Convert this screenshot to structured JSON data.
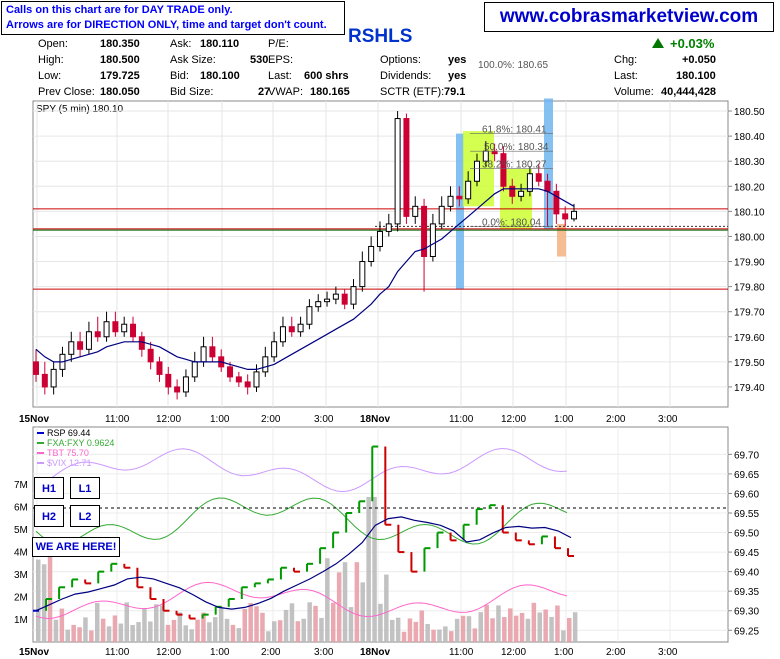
{
  "header": {
    "notice_line1": "Calls on this chart are for DAY TRADE only.",
    "notice_line2": "Arrows are for DIRECTION ONLY, time and target don't count.",
    "website": "www.cobrasmarketview.com",
    "symbol": "RSHLS",
    "change_pct": "+0.03%"
  },
  "quote": {
    "open_label": "Open:",
    "open": "180.350",
    "high_label": "High:",
    "high": "180.500",
    "low_label": "Low:",
    "low": "179.725",
    "prev_close_label": "Prev Close:",
    "prev_close": "180.050",
    "ask_label": "Ask:",
    "ask": "180.110",
    "ask_size_label": "Ask Size:",
    "ask_size": "530",
    "bid_label": "Bid:",
    "bid": "180.100",
    "bid_size_label": "Bid Size:",
    "bid_size": "27",
    "pe_label": "P/E:",
    "eps_label": "EPS:",
    "last_size_label": "Last:",
    "last_size": "600 shrs",
    "vwap_label": "VWAP:",
    "vwap": "180.165",
    "options_label": "Options:",
    "options": "yes",
    "dividends_label": "Dividends:",
    "dividends": "yes",
    "sctr_label": "SCTR (ETF):",
    "sctr": "79.1",
    "chg_label": "Chg:",
    "chg": "+0.050",
    "last_label": "Last:",
    "last": "180.100",
    "volume_label": "Volume:",
    "volume": "40,444,428"
  },
  "colors": {
    "up": "#000000",
    "down": "#cc0033",
    "ma": "#000080",
    "fib_blue": "#6fb6f0",
    "fib_green": "#ccff33",
    "fib_orange": "#f5b183",
    "hline": "#cc0000",
    "support": "#006600",
    "rsp_up": "#009900",
    "rsp_down": "#cc0000",
    "rsp_flat": "#0000cc",
    "fxy": "#33aa33",
    "tbt": "#ff66cc",
    "vix": "#cc99ff",
    "vol": "#bbbbbb",
    "vol_down": "#e8a0a8"
  },
  "labels": {
    "reset_h1": "H1",
    "reset_l1": "L1",
    "reset_h2": "H2",
    "reset_l2": "L2",
    "we_are_here": "WE ARE HERE!"
  },
  "chart_data": [
    {
      "type": "candlestick",
      "title": "SPY (5 min) 180.10",
      "x_ticks": [
        "15Nov",
        "11:00",
        "12:00",
        "1:00",
        "2:00",
        "3:00",
        "18Nov",
        "11:00",
        "12:00",
        "1:00",
        "2:00",
        "3:00"
      ],
      "ylim": [
        179.32,
        180.54
      ],
      "y_ticks": [
        180.5,
        180.4,
        180.3,
        180.2,
        180.1,
        180.0,
        179.9,
        179.8,
        179.7,
        179.6,
        179.5,
        179.4
      ],
      "close": [
        179.45,
        179.4,
        179.47,
        179.53,
        179.58,
        179.55,
        179.62,
        179.6,
        179.66,
        179.62,
        179.65,
        179.6,
        179.55,
        179.5,
        179.45,
        179.4,
        179.38,
        179.44,
        179.5,
        179.56,
        179.52,
        179.48,
        179.44,
        179.42,
        179.4,
        179.46,
        179.52,
        179.58,
        179.64,
        179.62,
        179.65,
        179.72,
        179.74,
        179.75,
        179.77,
        179.73,
        179.8,
        179.9,
        179.96,
        180.02,
        180.05,
        180.47,
        180.08,
        180.12,
        179.92,
        180.05,
        180.12,
        180.16,
        180.15,
        180.22,
        180.3,
        180.34,
        180.33,
        180.2,
        180.16,
        180.18,
        180.25,
        180.22,
        180.18,
        180.09,
        180.07,
        180.1
      ],
      "open": [
        179.5,
        179.45,
        179.4,
        179.47,
        179.53,
        179.58,
        179.55,
        179.62,
        179.6,
        179.66,
        179.62,
        179.65,
        179.6,
        179.55,
        179.5,
        179.45,
        179.4,
        179.38,
        179.44,
        179.5,
        179.56,
        179.52,
        179.48,
        179.44,
        179.42,
        179.4,
        179.46,
        179.52,
        179.58,
        179.64,
        179.62,
        179.65,
        179.72,
        179.74,
        179.75,
        179.77,
        179.73,
        179.8,
        179.9,
        179.96,
        180.02,
        180.05,
        180.47,
        180.08,
        180.12,
        179.92,
        180.05,
        180.12,
        180.16,
        180.15,
        180.22,
        180.3,
        180.34,
        180.33,
        180.2,
        180.16,
        180.18,
        180.25,
        180.22,
        180.18,
        180.09,
        180.07
      ],
      "high": [
        179.55,
        179.5,
        179.5,
        179.56,
        179.62,
        179.62,
        179.66,
        179.68,
        179.7,
        179.7,
        179.68,
        179.68,
        179.62,
        179.58,
        179.52,
        179.48,
        179.43,
        179.47,
        179.54,
        179.6,
        179.6,
        179.55,
        179.5,
        179.46,
        179.45,
        179.49,
        179.56,
        179.62,
        179.68,
        179.68,
        179.68,
        179.75,
        179.77,
        179.78,
        179.8,
        179.79,
        179.83,
        179.94,
        180.0,
        180.06,
        180.09,
        180.5,
        180.49,
        180.16,
        180.15,
        180.09,
        180.16,
        180.2,
        180.2,
        180.26,
        180.33,
        180.38,
        180.37,
        180.36,
        180.23,
        180.21,
        180.28,
        180.29,
        180.25,
        180.21,
        180.12,
        180.13
      ],
      "low": [
        179.42,
        179.37,
        179.37,
        179.44,
        179.5,
        179.52,
        179.53,
        179.58,
        179.58,
        179.6,
        179.6,
        179.58,
        179.52,
        179.47,
        179.42,
        179.37,
        179.35,
        179.36,
        179.42,
        179.48,
        179.5,
        179.46,
        179.42,
        179.4,
        179.37,
        179.38,
        179.44,
        179.5,
        179.56,
        179.6,
        179.6,
        179.63,
        179.7,
        179.72,
        179.73,
        179.71,
        179.71,
        179.78,
        179.88,
        179.94,
        180.0,
        180.02,
        180.05,
        180.05,
        179.78,
        179.9,
        180.03,
        180.1,
        180.12,
        180.13,
        180.2,
        180.28,
        180.3,
        180.18,
        180.13,
        180.14,
        180.16,
        180.2,
        180.04,
        180.05,
        180.04,
        180.06
      ],
      "moving_average": [
        179.55,
        179.52,
        179.5,
        179.5,
        179.51,
        179.52,
        179.53,
        179.54,
        179.56,
        179.57,
        179.58,
        179.58,
        179.58,
        179.57,
        179.56,
        179.54,
        179.52,
        179.51,
        179.5,
        179.5,
        179.5,
        179.5,
        179.49,
        179.48,
        179.47,
        179.47,
        179.48,
        179.49,
        179.51,
        179.53,
        179.55,
        179.57,
        179.59,
        179.61,
        179.63,
        179.65,
        179.67,
        179.7,
        179.73,
        179.77,
        179.8,
        179.86,
        179.9,
        179.94,
        179.95,
        179.97,
        179.99,
        180.02,
        180.05,
        180.08,
        180.11,
        180.14,
        180.17,
        180.19,
        180.19,
        180.19,
        180.19,
        180.19,
        180.18,
        180.16,
        180.14,
        180.12
      ],
      "fib_levels": [
        {
          "label": "100.0%: 180.65",
          "value": 180.65
        },
        {
          "label": "61.8%: 180.41",
          "value": 180.41
        },
        {
          "label": "50.0%: 180.34",
          "value": 180.34
        },
        {
          "label": "38.2%: 180.27",
          "value": 180.27
        },
        {
          "label": "0.0%: 180.04",
          "value": 180.04
        }
      ],
      "horizontal_lines": [
        180.11,
        180.03,
        179.79
      ]
    },
    {
      "type": "line",
      "series": [
        {
          "name": "RSP 69.44",
          "values": [
            69.3,
            69.33,
            69.36,
            69.38,
            69.37,
            69.4,
            69.42,
            69.41,
            69.36,
            69.33,
            69.3,
            69.29,
            69.28,
            69.29,
            69.31,
            69.33,
            69.36,
            69.37,
            69.38,
            69.41,
            69.4,
            69.42,
            69.46,
            69.5,
            69.55,
            69.58,
            69.72,
            69.52,
            69.45,
            69.4,
            69.46,
            69.5,
            69.48,
            69.52,
            69.56,
            69.57,
            69.5,
            69.48,
            69.47,
            69.49,
            69.46,
            69.44
          ]
        },
        {
          "name": "FXA:FXY 0.9624",
          "values": []
        },
        {
          "name": "TBT 75.70",
          "values": []
        },
        {
          "name": "$VIX 12.71",
          "values": []
        }
      ],
      "ylim": [
        69.22,
        69.77
      ],
      "y_ticks": [
        69.7,
        69.65,
        69.6,
        69.55,
        69.5,
        69.45,
        69.4,
        69.35,
        69.3,
        69.25
      ],
      "volume_ticks": [
        "7M",
        "6M",
        "5M",
        "4M",
        "3M",
        "2M",
        "1M"
      ],
      "x_ticks": [
        "15Nov",
        "11:00",
        "12:00",
        "1:00",
        "2:00",
        "3:00",
        "18Nov",
        "11:00",
        "12:00",
        "1:00",
        "2:00",
        "3:00"
      ]
    }
  ]
}
